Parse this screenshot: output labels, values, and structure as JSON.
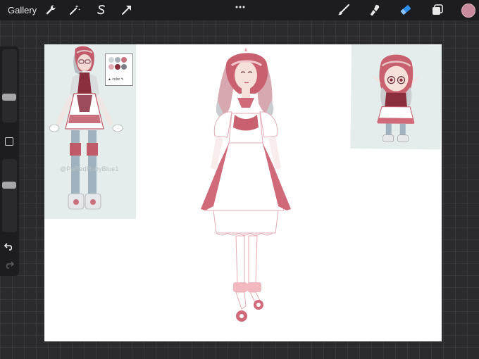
{
  "toolbar": {
    "gallery_label": "Gallery",
    "left_tools": [
      "wrench-icon",
      "magic-wand-icon",
      "selection-icon",
      "transform-arrow-icon"
    ],
    "right_tools": [
      "brush-icon",
      "smudge-icon",
      "eraser-icon",
      "layers-icon"
    ],
    "active_tool": "eraser-icon",
    "accent_color": "#2f8ff0",
    "current_color": "#c98a9b"
  },
  "sidebar": {
    "brush_size_level": 0.22,
    "opacity_level": 0.38
  },
  "canvas": {
    "reference_sheet": {
      "palette_colors": [
        "#cfd6da",
        "#a7b2b8",
        "#c9707f",
        "#e2b0b8",
        "#8a2e3e",
        "#7c7f85"
      ],
      "palette_caption": "▲ color ✎",
      "watermark": "@PaRedRubyBlue1"
    }
  }
}
